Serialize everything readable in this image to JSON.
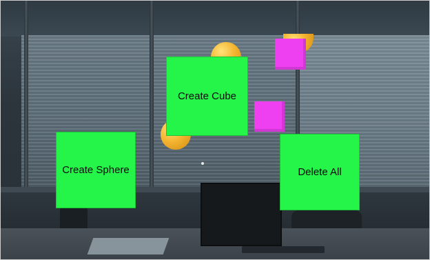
{
  "buttons": {
    "create_cube": "Create Cube",
    "create_sphere": "Create Sphere",
    "delete_all": "Delete All"
  },
  "hologram_objects": {
    "spheres": 3,
    "cubes": 2
  },
  "colors": {
    "button_green": "#25f548",
    "cube_magenta": "#ee3ff0",
    "sphere_orange": "#f4b531"
  }
}
